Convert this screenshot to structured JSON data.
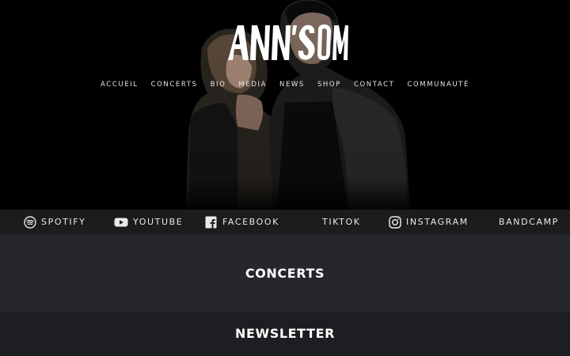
{
  "site": {
    "logo_text": "ANN'SO M",
    "colors": {
      "background": "#000000",
      "social_bar": "#1c1c1c",
      "concerts_bg": "#25272c",
      "newsletter_bg": "#1d1e22",
      "text": "#ffffff"
    }
  },
  "nav": {
    "items": [
      {
        "label": "ACCUEIL"
      },
      {
        "label": "CONCERTS"
      },
      {
        "label": "BIO"
      },
      {
        "label": "MEDIA"
      },
      {
        "label": "NEWS"
      },
      {
        "label": "SHOP"
      },
      {
        "label": "CONTACT"
      },
      {
        "label": "COMMUNAUTÉ"
      }
    ]
  },
  "social": {
    "items": [
      {
        "label": "SPOTIFY",
        "icon": "spotify-icon"
      },
      {
        "label": "YOUTUBE",
        "icon": "youtube-icon"
      },
      {
        "label": "FACEBOOK",
        "icon": "facebook-icon"
      },
      {
        "label": "TIKTOK",
        "icon": "tiktok-icon"
      },
      {
        "label": "INSTAGRAM",
        "icon": "instagram-icon"
      },
      {
        "label": "BANDCAMP",
        "icon": "bandcamp-icon"
      }
    ]
  },
  "sections": {
    "concerts_title": "CONCERTS",
    "newsletter_title": "NEWSLETTER"
  }
}
